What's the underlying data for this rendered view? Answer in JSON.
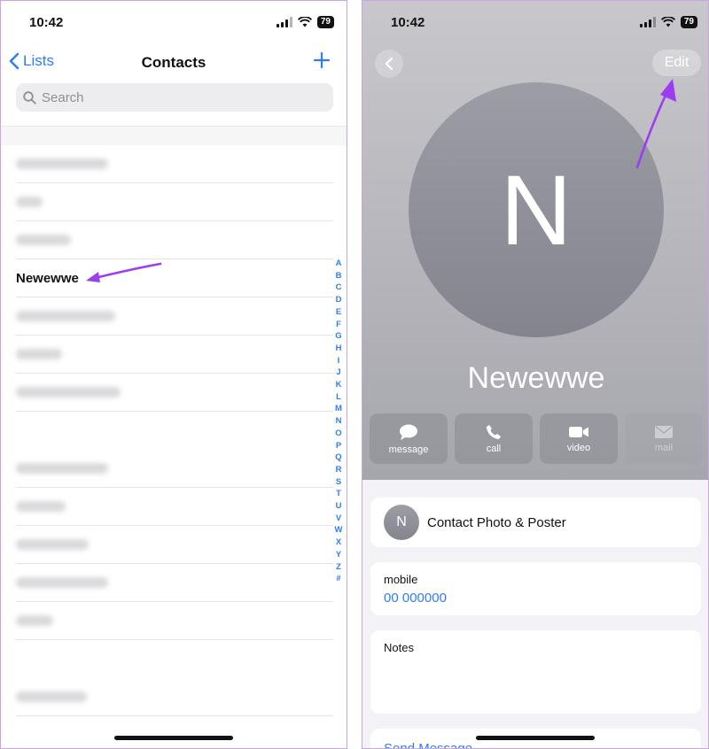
{
  "left": {
    "status": {
      "time": "10:42",
      "battery": "79"
    },
    "nav": {
      "back_label": "Lists",
      "title": "Contacts"
    },
    "search": {
      "placeholder": "Search"
    },
    "highlighted_contact": "Newewwe",
    "index_letters": [
      "A",
      "B",
      "C",
      "D",
      "E",
      "F",
      "G",
      "H",
      "I",
      "J",
      "K",
      "L",
      "M",
      "N",
      "O",
      "P",
      "Q",
      "R",
      "S",
      "T",
      "U",
      "V",
      "W",
      "X",
      "Y",
      "Z",
      "#"
    ]
  },
  "right": {
    "status": {
      "time": "10:42",
      "battery": "79"
    },
    "edit_label": "Edit",
    "avatar_initial": "N",
    "contact_name": "Newewwe",
    "actions": [
      {
        "label": "message",
        "icon": "message-icon",
        "enabled": true
      },
      {
        "label": "call",
        "icon": "phone-icon",
        "enabled": true
      },
      {
        "label": "video",
        "icon": "video-icon",
        "enabled": true
      },
      {
        "label": "mail",
        "icon": "mail-icon",
        "enabled": false
      }
    ],
    "photo_card": {
      "initial": "N",
      "label": "Contact Photo & Poster"
    },
    "phone_card": {
      "label": "mobile",
      "value": "00 000000"
    },
    "notes_card": {
      "label": "Notes"
    },
    "send_message_label": "Send Message"
  },
  "colors": {
    "accent": "#2f7cf6",
    "annotation_arrow": "#9b3df0"
  }
}
